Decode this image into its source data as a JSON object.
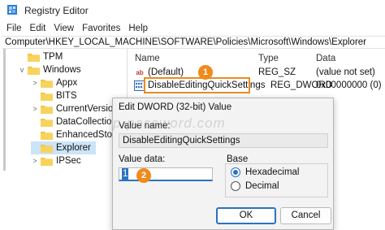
{
  "window": {
    "title": "Registry Editor"
  },
  "menu": [
    "File",
    "Edit",
    "View",
    "Favorites",
    "Help"
  ],
  "address": "Computer\\HKEY_LOCAL_MACHINE\\SOFTWARE\\Policies\\Microsoft\\Windows\\Explorer",
  "tree": [
    {
      "label": "TPM",
      "expander": "",
      "selected": false
    },
    {
      "label": "Windows",
      "expander": "v",
      "selected": false
    },
    {
      "label": "Appx",
      "expander": ">",
      "selected": false
    },
    {
      "label": "BITS",
      "expander": "",
      "selected": false
    },
    {
      "label": "CurrentVersion",
      "expander": ">",
      "selected": false
    },
    {
      "label": "DataCollection",
      "expander": "",
      "selected": false
    },
    {
      "label": "EnhancedStorag",
      "expander": "",
      "selected": false
    },
    {
      "label": "Explorer",
      "expander": "",
      "selected": true
    },
    {
      "label": "IPSec",
      "expander": ">",
      "selected": false
    }
  ],
  "list": {
    "headers": {
      "name": "Name",
      "type": "Type",
      "data": "Data"
    },
    "rows": [
      {
        "icon": "ab",
        "name": "(Default)",
        "type": "REG_SZ",
        "data": "(value not set)"
      },
      {
        "icon": "dword-icon",
        "name": "DisableEditingQuickSettings",
        "type": "REG_DWORD",
        "data": "0x00000000 (0)"
      }
    ]
  },
  "badges": {
    "one": "1",
    "two": "2"
  },
  "dialog": {
    "title": "Edit DWORD (32-bit) Value",
    "value_name_label": "Value name:",
    "value_name": "DisableEditingQuickSettings",
    "value_data_label": "Value data:",
    "value_data": "1",
    "base_label": "Base",
    "hex_label": "Hexadecimal",
    "dec_label": "Decimal",
    "base_selected": "Hexadecimal",
    "ok_label": "OK",
    "cancel_label": "Cancel"
  },
  "watermark": "p-password.com",
  "colors": {
    "accent": "#2b72c2",
    "badge": "#f08a1c",
    "folder": "#f3c544",
    "selection": "#cce4f7"
  }
}
